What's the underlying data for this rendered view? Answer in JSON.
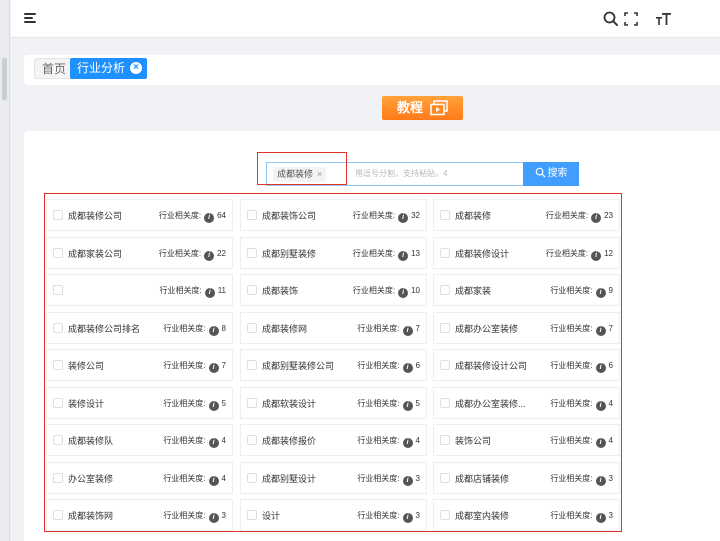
{
  "topbar": {
    "icons": [
      "menu-icon",
      "search-icon",
      "fullscreen-icon",
      "font-size-icon"
    ]
  },
  "tags": {
    "home": "首页",
    "active": "行业分析"
  },
  "tutorial": {
    "label": "教程",
    "icon": "video-icon"
  },
  "search": {
    "keyword": "成都装修",
    "remove": "×",
    "placeholder": "用逗号分割，支持粘贴，4",
    "button": "搜索"
  },
  "relevance_label": "行业相关度:",
  "info_glyph": "i",
  "results": [
    [
      {
        "kw": "成都装修公司",
        "score": "64"
      },
      {
        "kw": "成都装饰公司",
        "score": "32"
      },
      {
        "kw": "成都装修",
        "score": "23"
      }
    ],
    [
      {
        "kw": "成都家装公司",
        "score": "22"
      },
      {
        "kw": "成都别墅装修",
        "score": "13"
      },
      {
        "kw": "成都装修设计",
        "score": "12"
      }
    ],
    [
      {
        "kw": "",
        "score": "11"
      },
      {
        "kw": "成都装饰",
        "score": "10"
      },
      {
        "kw": "成都家装",
        "score": "9"
      }
    ],
    [
      {
        "kw": "成都装修公司排名",
        "score": "8"
      },
      {
        "kw": "成都装修网",
        "score": "7"
      },
      {
        "kw": "成都办公室装修",
        "score": "7"
      }
    ],
    [
      {
        "kw": "装修公司",
        "score": "7"
      },
      {
        "kw": "成都别墅装修公司",
        "score": "6"
      },
      {
        "kw": "成都装修设计公司",
        "score": "6"
      }
    ],
    [
      {
        "kw": "装修设计",
        "score": "5"
      },
      {
        "kw": "成都软装设计",
        "score": "5"
      },
      {
        "kw": "成都办公室装修...",
        "score": "4"
      }
    ],
    [
      {
        "kw": "成都装修队",
        "score": "4"
      },
      {
        "kw": "成都装修报价",
        "score": "4"
      },
      {
        "kw": "装饰公司",
        "score": "4"
      }
    ],
    [
      {
        "kw": "办公室装修",
        "score": "4"
      },
      {
        "kw": "成都别墅设计",
        "score": "3"
      },
      {
        "kw": "成都店铺装修",
        "score": "3"
      }
    ],
    [
      {
        "kw": "成都装饰网",
        "score": "3"
      },
      {
        "kw": "设计",
        "score": "3"
      },
      {
        "kw": "成都室内装修",
        "score": "3"
      }
    ]
  ]
}
